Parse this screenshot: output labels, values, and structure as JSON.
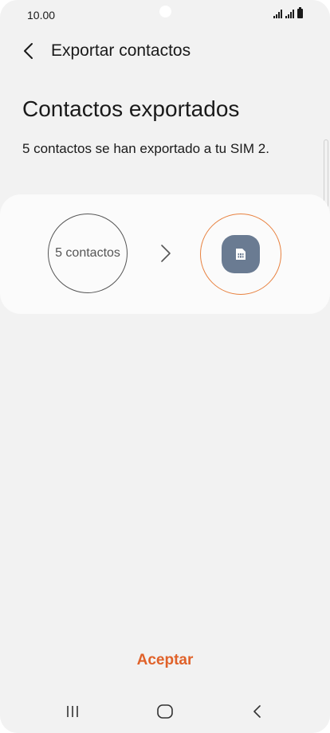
{
  "status_bar": {
    "time": "10.00",
    "icons": [
      "signal-sim1-icon",
      "signal-sim2-icon",
      "battery-icon"
    ]
  },
  "header": {
    "back_icon": "chevron-left-icon",
    "title": "Exportar contactos"
  },
  "main": {
    "title": "Contactos exportados",
    "message": "5 contactos se han exportado a tu SIM 2."
  },
  "export_card": {
    "source_label": "5 contactos",
    "arrow_icon": "chevron-right-icon",
    "target_icon": "sim-card-icon"
  },
  "footer": {
    "accept_label": "Aceptar"
  },
  "navigation": {
    "buttons": [
      "recent-apps-icon",
      "home-icon",
      "back-icon"
    ]
  },
  "colors": {
    "accent": "#e0622a",
    "target_ring": "#e8813f",
    "sim_badge": "#6a7b92",
    "background": "#f2f2f2",
    "card": "#fbfbfb"
  }
}
